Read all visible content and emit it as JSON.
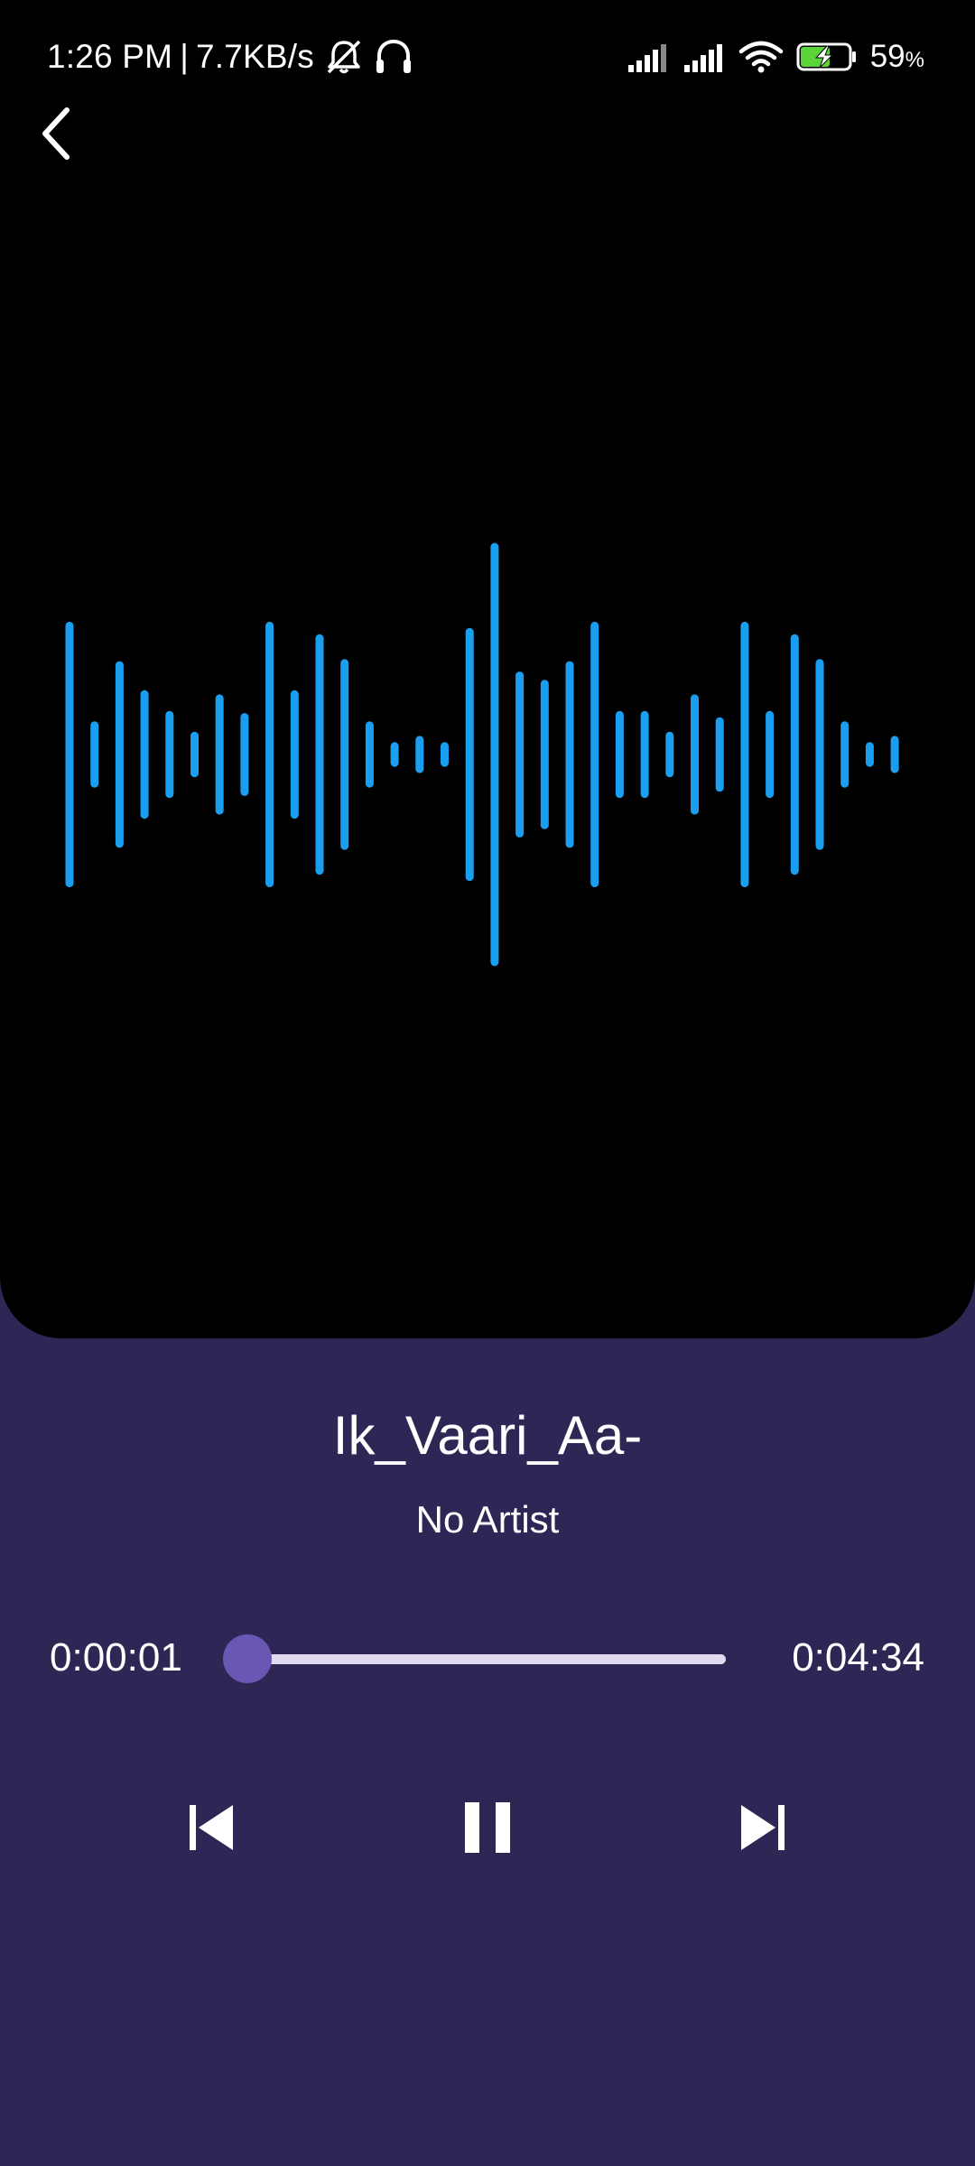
{
  "status_bar": {
    "time": "1:26 PM",
    "separator": "|",
    "net_speed": "7.7KB/s",
    "battery_percent": "59",
    "battery_unit": "%",
    "icons": [
      "mute-icon",
      "headphones-icon",
      "signal-icon",
      "signal-icon",
      "wifi-icon",
      "battery-charging-icon"
    ]
  },
  "player": {
    "title": "Ik_Vaari_Aa-",
    "artist": "No Artist",
    "current_time": "0:00:01",
    "total_time": "0:04:34",
    "progress": 0.0
  },
  "controls": {
    "icons": [
      "skip-previous-icon",
      "pause-icon",
      "skip-next-icon"
    ]
  },
  "waveform": {
    "color": "#1a9ff0",
    "bar_heights": [
      0.62,
      0.14,
      0.43,
      0.29,
      0.19,
      0.09,
      0.27,
      0.18,
      0.62,
      0.29,
      0.56,
      0.44,
      0.14,
      0.04,
      0.07,
      0.04,
      0.59,
      1.0,
      0.38,
      0.34,
      0.43,
      0.62,
      0.19,
      0.19,
      0.09,
      0.27,
      0.16,
      0.62,
      0.19,
      0.56,
      0.44,
      0.14,
      0.04,
      0.07
    ]
  },
  "colors": {
    "background": "#2e2756",
    "accent": "#6a57b4",
    "track": "#e2dbef",
    "wave": "#1a9ff0"
  }
}
